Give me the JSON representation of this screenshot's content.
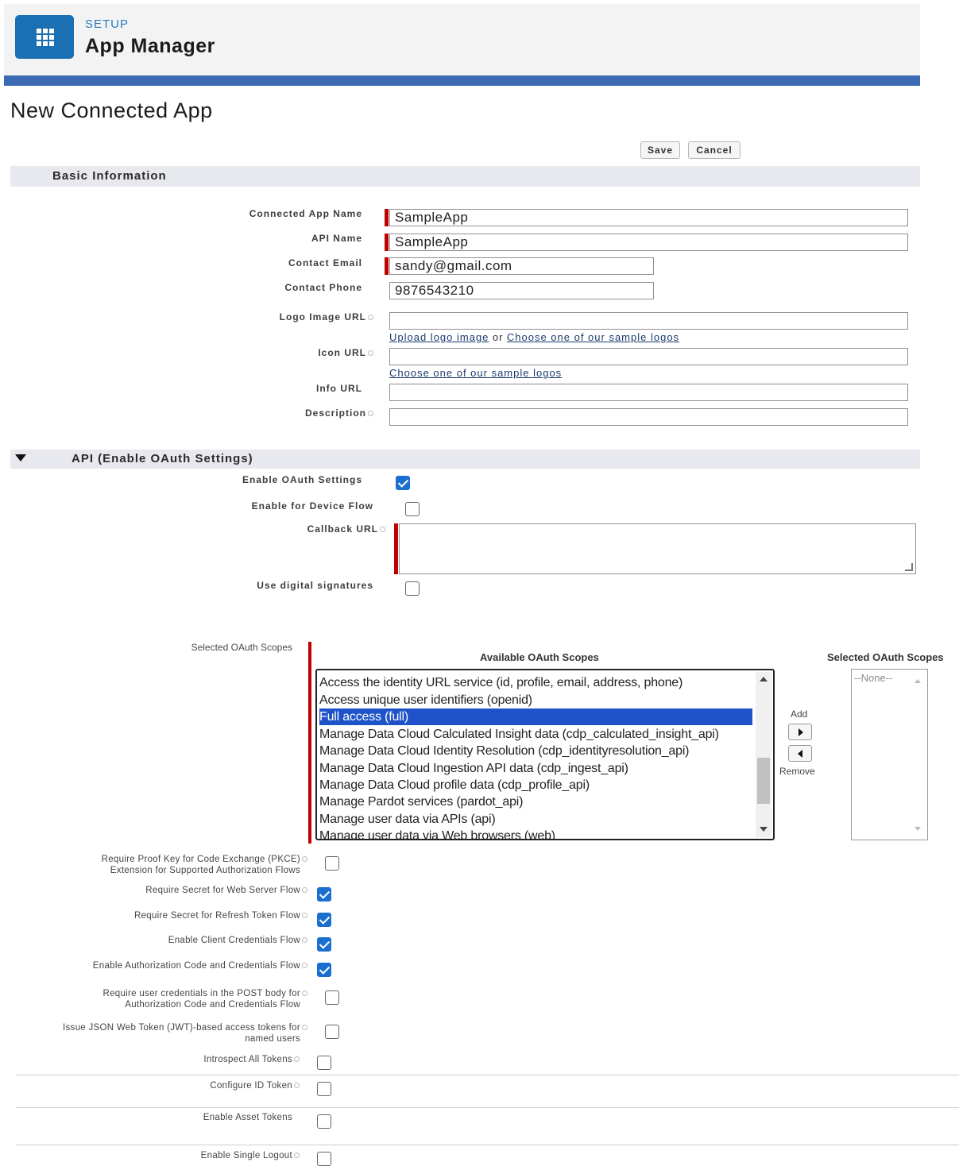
{
  "header": {
    "setup_label": "SETUP",
    "title": "App Manager",
    "icon": "app-grid-icon"
  },
  "page": {
    "title": "New Connected App"
  },
  "toolbar": {
    "save_label": "Save",
    "cancel_label": "Cancel"
  },
  "basic_info": {
    "section_title": "Basic Information",
    "fields": {
      "app_name": {
        "label": "Connected App Name",
        "value": "SampleApp"
      },
      "api_name": {
        "label": "API Name",
        "value": "SampleApp"
      },
      "contact_email": {
        "label": "Contact Email",
        "value": "sandy@gmail.com"
      },
      "contact_phone": {
        "label": "Contact Phone",
        "value": "9876543210"
      },
      "logo_url": {
        "label": "Logo Image URL",
        "value": ""
      },
      "icon_url": {
        "label": "Icon URL",
        "value": ""
      },
      "info_url": {
        "label": "Info URL",
        "value": ""
      },
      "description": {
        "label": "Description",
        "value": ""
      }
    },
    "logo_links": {
      "upload": "Upload logo image",
      "or": "or",
      "choose": "Choose one of our sample logos"
    },
    "icon_links": {
      "choose": "Choose one of our sample logos"
    }
  },
  "api_section": {
    "section_title": "API (Enable OAuth Settings)",
    "enable_oauth": {
      "label": "Enable OAuth Settings",
      "checked": true
    },
    "device_flow": {
      "label": "Enable for Device Flow",
      "checked": false
    },
    "callback_url": {
      "label": "Callback URL",
      "value": ""
    },
    "digital_signatures": {
      "label": "Use digital signatures",
      "checked": false
    },
    "scopes": {
      "label": "Selected OAuth Scopes",
      "available_header": "Available OAuth Scopes",
      "selected_header": "Selected OAuth Scopes",
      "available": [
        "Access the identity URL service (id, profile, email, address, phone)",
        "Access unique user identifiers (openid)",
        "Full access (full)",
        "Manage Data Cloud Calculated Insight data (cdp_calculated_insight_api)",
        "Manage Data Cloud Identity Resolution (cdp_identityresolution_api)",
        "Manage Data Cloud Ingestion API data (cdp_ingest_api)",
        "Manage Data Cloud profile data (cdp_profile_api)",
        "Manage Pardot services (pardot_api)",
        "Manage user data via APIs (api)",
        "Manage user data via Web browsers (web)"
      ],
      "selected_index": 2,
      "selected_list": [
        "--None--"
      ],
      "add_label": "Add",
      "remove_label": "Remove"
    },
    "options": [
      {
        "label_line1": "Require Proof Key for Code Exchange (PKCE)",
        "label_line2": "Extension for Supported Authorization Flows",
        "checked": false
      },
      {
        "label_line1": "Require Secret for Web Server Flow",
        "label_line2": "",
        "checked": true
      },
      {
        "label_line1": "Require Secret for Refresh Token Flow",
        "label_line2": "",
        "checked": true
      },
      {
        "label_line1": "Enable Client Credentials Flow",
        "label_line2": "",
        "checked": true
      },
      {
        "label_line1": "Enable Authorization Code and Credentials Flow",
        "label_line2": "",
        "checked": true
      },
      {
        "label_line1": "Require user credentials in the POST body for",
        "label_line2": "Authorization Code and Credentials Flow",
        "checked": false
      },
      {
        "label_line1": "Issue JSON Web Token (JWT)-based access tokens for",
        "label_line2": "named users",
        "checked": false
      },
      {
        "label_line1": "Introspect All Tokens",
        "label_line2": "",
        "checked": false
      },
      {
        "label_line1": "Configure ID Token",
        "label_line2": "",
        "checked": false
      },
      {
        "label_line1": "Enable Asset Tokens",
        "label_line2": "",
        "checked": false
      },
      {
        "label_line1": "Enable Single Logout",
        "label_line2": "",
        "checked": false
      }
    ]
  },
  "colors": {
    "brand_blue": "#1b6fb3",
    "band_blue": "#3d6bb3",
    "required_red": "#c00000",
    "selection_blue": "#1e52c8",
    "checkbox_blue": "#1a6fd0"
  }
}
